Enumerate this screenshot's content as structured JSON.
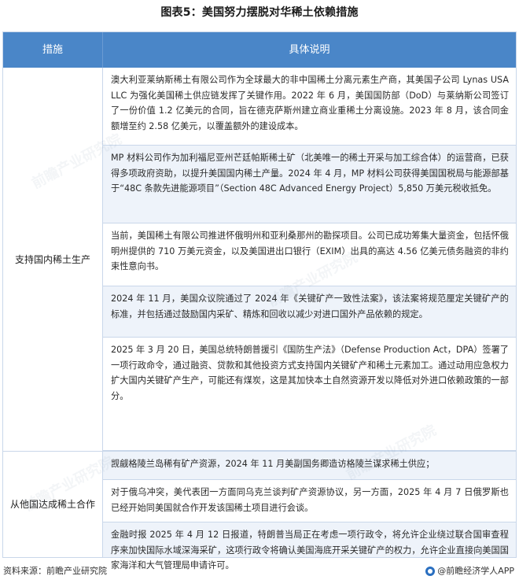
{
  "title": "图表5：美国努力摆脱对华稀土依赖措施",
  "table": {
    "headers": [
      "措施",
      "具体说明"
    ],
    "groups": [
      {
        "label": "支持国内稀土生产",
        "rows": [
          "澳大利亚莱纳斯稀土有限公司作为全球最大的非中国稀土分离元素生产商，其美国子公司 Lynas USA LLC 为强化美国稀土供应链发挥了关键作用。2022 年 6 月，美国国防部（DoD）与莱纳斯公司签订了一份价值 1.2 亿美元的合同，旨在德克萨斯州建立商业重稀土分离设施。2023 年 8 月，该合同金额增至约 2.58 亿美元，以覆盖额外的建设成本。",
          "MP 材料公司作为加利福尼亚州芒廷帕斯稀土矿（北美唯一的稀土开采与加工综合体）的运营商，已获得多项政府资助，以提升美国国内稀土产量。2024 年 4 月，MP 材料公司获得美国国税局与能源部基于“48C 条款先进能源项目”（Section 48C Advanced Energy Project）5,850 万美元税收抵免。",
          "当前，美国稀土有限公司推进怀俄明州和亚利桑那州的勘探项目。公司已成功筹集大量资金，包括怀俄明州提供的 710 万美元资金，以及美国进出口银行（EXIM）出具的高达 4.56 亿美元债务融资的非约束性意向书。",
          "2024 年 11 月，美国众议院通过了 2024 年《关键矿产一致性法案》，该法案将规范厘定关键矿产的标准，并包括通过鼓励国内采矿、精炼和回收以减少对进口国外产品依赖的规定。",
          "2025 年 3 月 20 日，美国总统特朗普援引《国防生产法》（Defense Production Act，DPA）签署了一项行政命令，通过融资、贷款和其他投资方式支持国内关键矿产和稀土元素加工。通过动用应急权力扩大国内关键矿产生产，可能还有煤炭，这是其加快本土自然资源开发以降低对外进口依赖政策的一部分。"
        ]
      },
      {
        "label": "从他国达成稀土合作",
        "rows": [
          "觊觎格陵兰岛稀有矿产资源，2024 年 11 月美副国务卿造访格陵兰谋求稀土供应；",
          "对于俄乌冲突，美代表团一方面同乌克兰谈判矿产资源协议，另一方面，2025 年 4 月 7 日俄罗斯也已经开始同美国就合作开发该国稀土项目进行会谈。",
          "金融时报 2025 年 4 月 12 日报道，特朗普当局正在考虑一项行政令，将允许企业绕过联合国审查程序来加快国际水域深海采矿，这项行政令将确认美国海底开采关键矿产的权力，允许企业直接向美国国家海洋和大气管理局申请许可。"
        ]
      }
    ]
  },
  "footer": {
    "source": "资料来源：前瞻产业研究院",
    "brand": "@前瞻经济学人APP"
  },
  "watermark": "前瞻产业研究院",
  "colors": {
    "header_bg": "#4a86c8",
    "row_shade": "#eef3fa",
    "border": "#c9d7ea"
  }
}
